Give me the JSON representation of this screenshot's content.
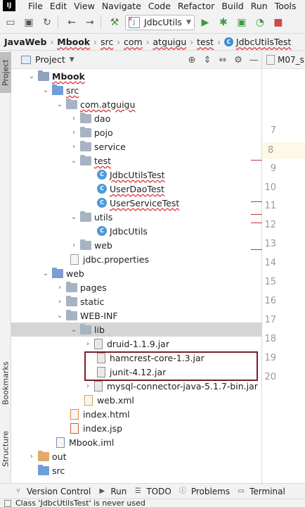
{
  "menubar": {
    "logo": "IJ",
    "items": [
      {
        "label": "File"
      },
      {
        "label": "Edit"
      },
      {
        "label": "View"
      },
      {
        "label": "Navigate"
      },
      {
        "label": "Code"
      },
      {
        "label": "Refactor"
      },
      {
        "label": "Build"
      },
      {
        "label": "Run"
      },
      {
        "label": "Tools"
      }
    ]
  },
  "toolbar": {
    "run_config": "JdbcUtils",
    "icons": [
      "open-icon",
      "save-all-icon",
      "sync-icon",
      "back-icon",
      "forward-icon",
      "build-icon",
      "run-icon",
      "debug-icon",
      "coverage-icon",
      "profile-icon",
      "stop-icon"
    ]
  },
  "breadcrumb": {
    "items": [
      "JavaWeb",
      "Mbook",
      "src",
      "com",
      "atguigu",
      "test",
      "JdbcUtilsTest"
    ]
  },
  "sidebar": {
    "tabs": [
      {
        "label": "Project",
        "active": true
      },
      {
        "label": "Bookmarks",
        "active": false
      },
      {
        "label": "Structure",
        "active": false
      }
    ]
  },
  "project_panel": {
    "title": "Project",
    "tree": [
      {
        "label": "Mbook",
        "expanded": true
      },
      {
        "label": "src",
        "expanded": true
      },
      {
        "label": "com.atguigu",
        "expanded": true
      },
      {
        "label": "dao",
        "expanded": false
      },
      {
        "label": "pojo",
        "expanded": false
      },
      {
        "label": "service",
        "expanded": false
      },
      {
        "label": "test",
        "expanded": true
      },
      {
        "label": "JdbcUtilsTest"
      },
      {
        "label": "UserDaoTest"
      },
      {
        "label": "UserServiceTest"
      },
      {
        "label": "utils",
        "expanded": true
      },
      {
        "label": "JdbcUtils"
      },
      {
        "label": "web",
        "expanded": false
      },
      {
        "label": "jdbc.properties"
      },
      {
        "label": "web",
        "expanded": true
      },
      {
        "label": "pages",
        "expanded": false
      },
      {
        "label": "static",
        "expanded": false
      },
      {
        "label": "WEB-INF",
        "expanded": true
      },
      {
        "label": "lib",
        "expanded": true,
        "selected": true
      },
      {
        "label": "druid-1.1.9.jar",
        "expanded": false
      },
      {
        "label": "hamcrest-core-1.3.jar"
      },
      {
        "label": "junit-4.12.jar"
      },
      {
        "label": "mysql-connector-java-5.1.7-bin.jar",
        "expanded": false
      },
      {
        "label": "web.xml"
      },
      {
        "label": "index.html"
      },
      {
        "label": "index.jsp"
      },
      {
        "label": "Mbook.iml"
      },
      {
        "label": "out",
        "expanded": false
      },
      {
        "label": "src"
      }
    ]
  },
  "editor": {
    "tab_label": "M07_s",
    "line_numbers": [
      "7",
      "8",
      "9",
      "10",
      "11",
      "12",
      "13",
      "14",
      "15",
      "16",
      "17",
      "18",
      "19",
      "20"
    ],
    "current_line": "8"
  },
  "bottom_tools": [
    {
      "label": "Version Control"
    },
    {
      "label": "Run"
    },
    {
      "label": "TODO"
    },
    {
      "label": "Problems"
    },
    {
      "label": "Terminal"
    }
  ],
  "status": {
    "message": "Class 'JdbcUtilsTest' is never used"
  }
}
